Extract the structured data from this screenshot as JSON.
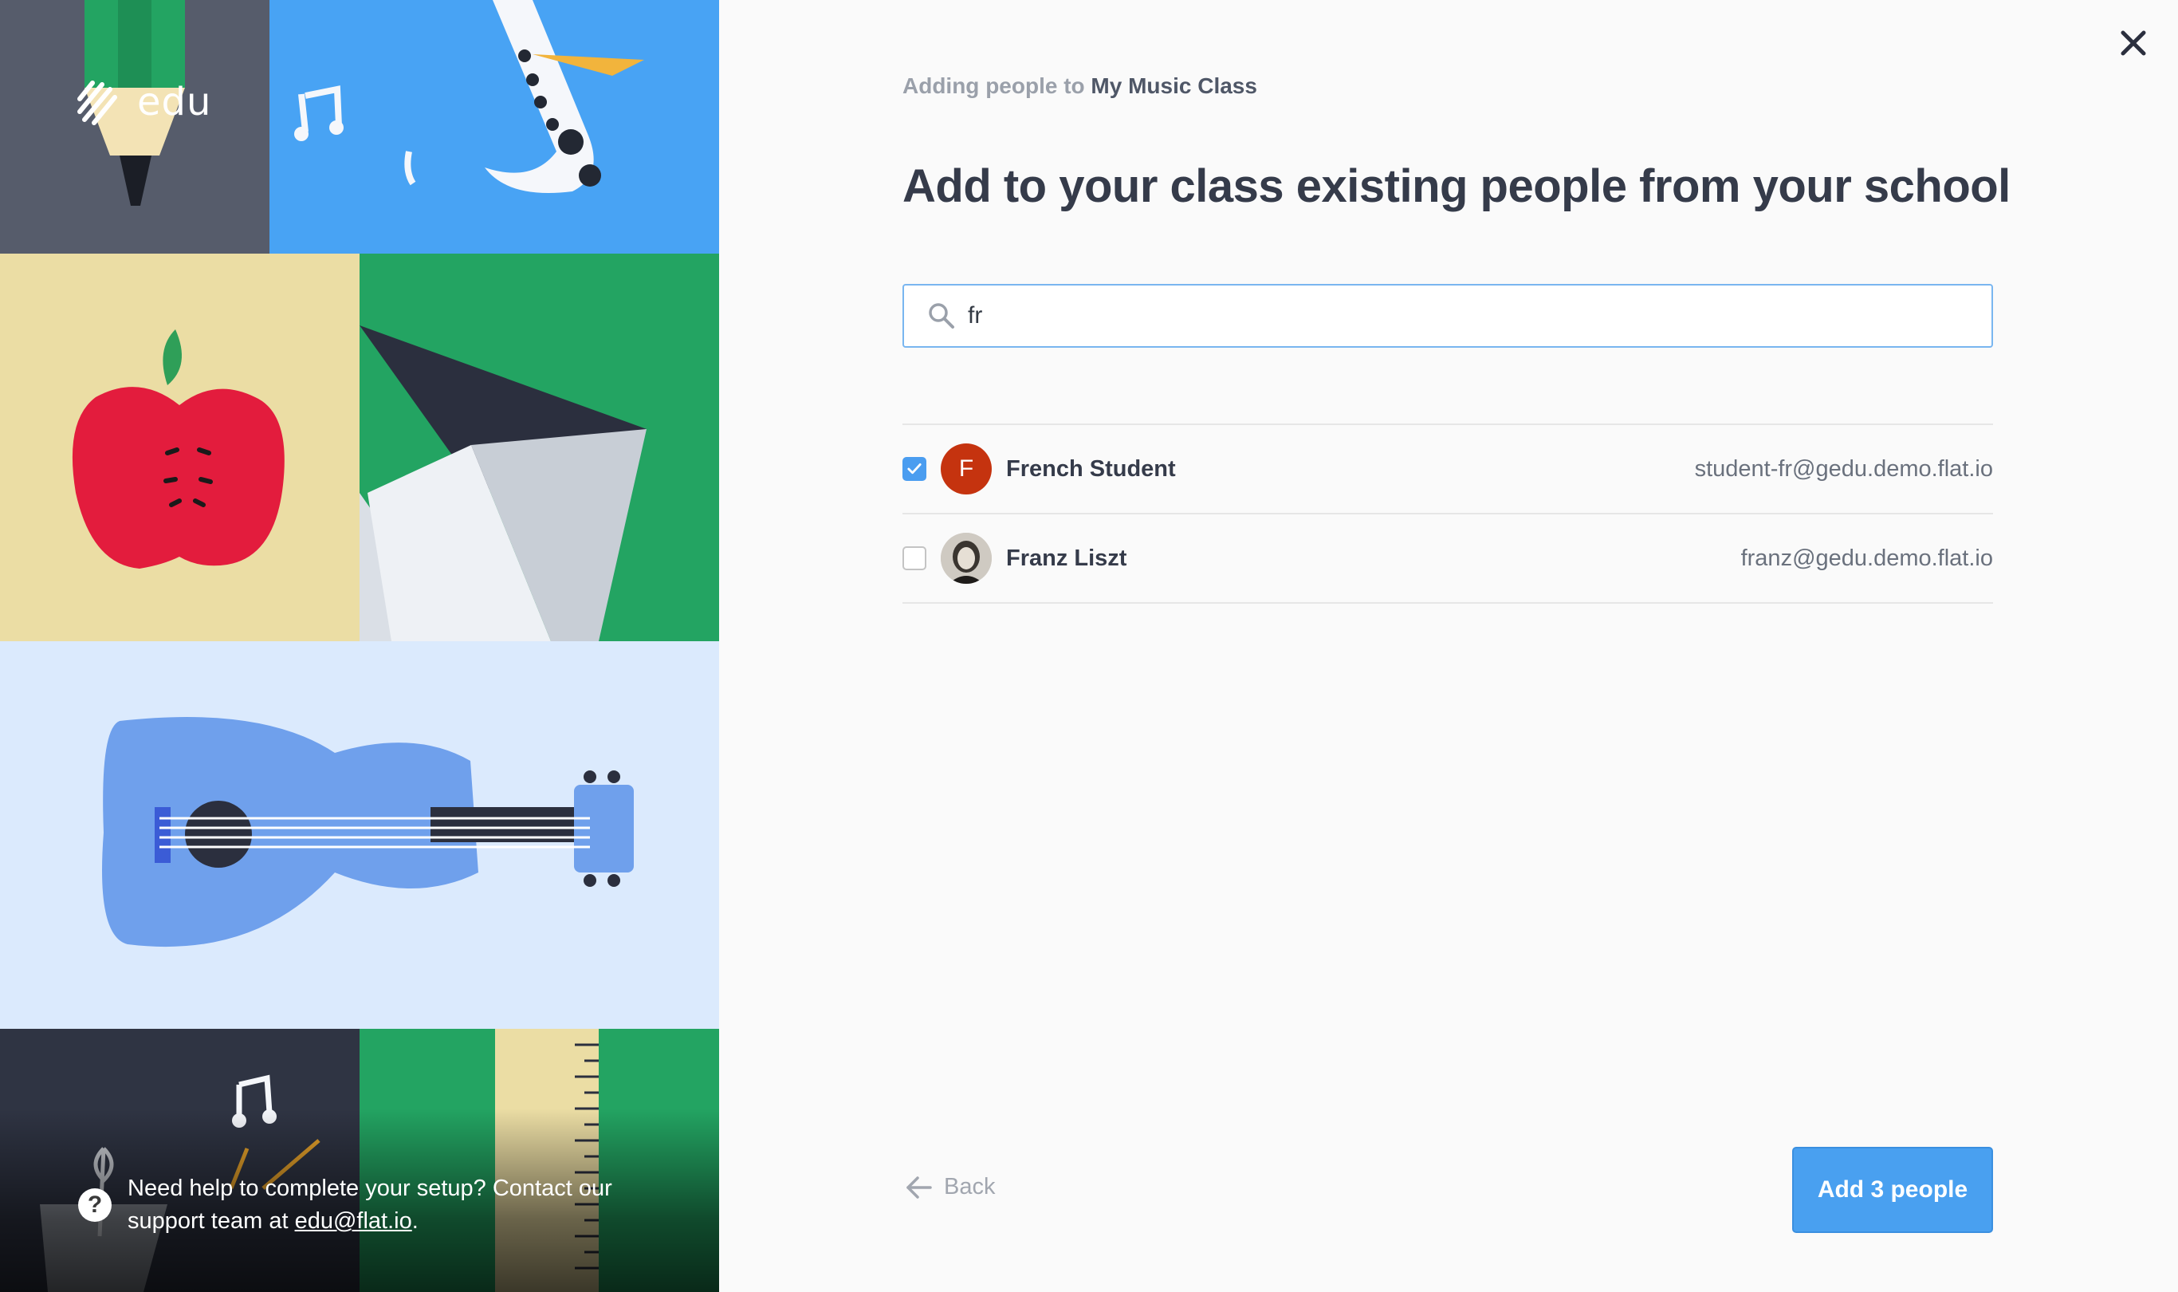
{
  "brand": {
    "logo_text": "edu"
  },
  "help": {
    "text_before": "Need help to complete your setup? Contact our support team at ",
    "link": "edu@flat.io",
    "text_after": "."
  },
  "breadcrumb": {
    "prefix": "Adding people to ",
    "class_name": "My Music Class"
  },
  "page_title": "Add to your class existing people from your school",
  "search": {
    "value": "fr",
    "icon": "search-icon"
  },
  "people": [
    {
      "name": "French Student",
      "email": "student-fr@gedu.demo.flat.io",
      "checked": true,
      "avatar_letter": "F"
    },
    {
      "name": "Franz Liszt",
      "email": "franz@gedu.demo.flat.io",
      "checked": false,
      "avatar_letter": ""
    }
  ],
  "footer": {
    "back_label": "Back",
    "add_label": "Add 3 people"
  },
  "colors": {
    "accent": "#4a9df0",
    "title": "#353b4a",
    "avatar_f": "#c5330f"
  }
}
